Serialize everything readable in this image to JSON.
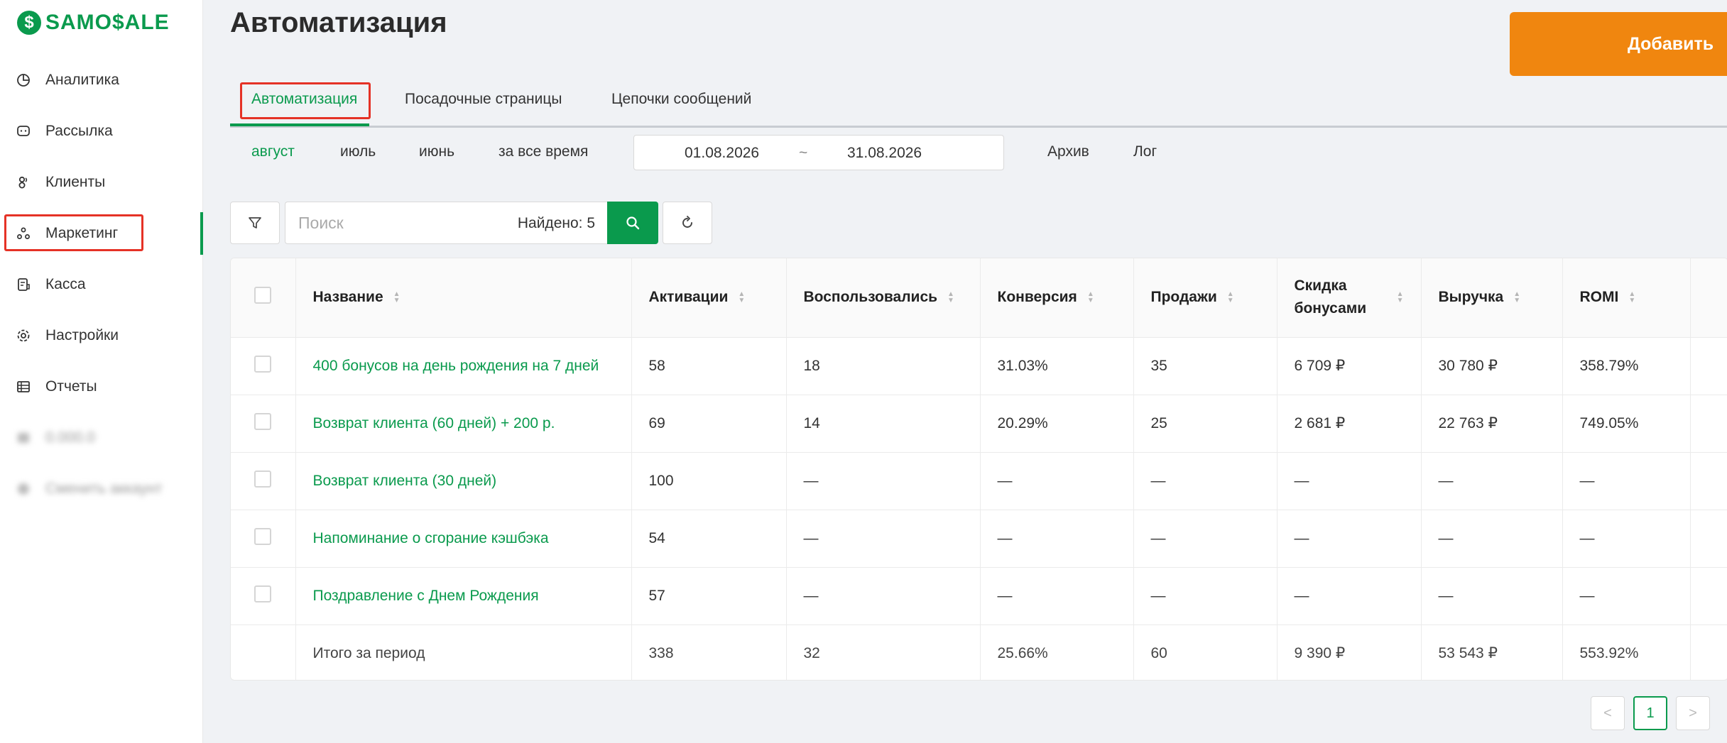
{
  "brand": {
    "logo_glyph": "$",
    "name": "SAMO$ALE",
    "color": "#0a9a4d"
  },
  "sidebar": {
    "items": [
      {
        "label": "Аналитика",
        "icon": "pie-chart-icon"
      },
      {
        "label": "Рассылка",
        "icon": "message-icon"
      },
      {
        "label": "Клиенты",
        "icon": "users-icon"
      },
      {
        "label": "Маркетинг",
        "icon": "marketing-icon",
        "active": true
      },
      {
        "label": "Касса",
        "icon": "cash-register-icon"
      },
      {
        "label": "Настройки",
        "icon": "gear-icon"
      },
      {
        "label": "Отчеты",
        "icon": "table-icon"
      },
      {
        "label": "0.000.0",
        "icon": "blurred-icon"
      },
      {
        "label": "Сменить аккаунт",
        "icon": "blurred-icon"
      }
    ]
  },
  "header": {
    "title": "Автоматизация",
    "add_label": "Добавить",
    "accent": "#f0860f"
  },
  "tabs": [
    {
      "label": "Автоматизация",
      "active": true
    },
    {
      "label": "Посадочные страницы"
    },
    {
      "label": "Цепочки сообщений"
    }
  ],
  "periods": [
    {
      "label": "август",
      "active": true
    },
    {
      "label": "июль"
    },
    {
      "label": "июнь"
    },
    {
      "label": "за все время"
    }
  ],
  "date_range": {
    "from": "01.08.2026",
    "sep": "~",
    "to": "31.08.2026"
  },
  "links": {
    "archive": "Архив",
    "log": "Лог"
  },
  "search": {
    "placeholder": "Поиск",
    "found": "Найдено: 5"
  },
  "table": {
    "columns": [
      "Название",
      "Активации",
      "Воспользовались",
      "Конверсия",
      "Продажи",
      "Скидка бонусами",
      "Выручка",
      "ROMI"
    ],
    "rows": [
      [
        "400 бонусов на день рождения на 7 дней",
        "58",
        "18",
        "31.03%",
        "35",
        "6 709 ₽",
        "30 780 ₽",
        "358.79%"
      ],
      [
        "Возврат клиента (60 дней) + 200 р.",
        "69",
        "14",
        "20.29%",
        "25",
        "2 681 ₽",
        "22 763 ₽",
        "749.05%"
      ],
      [
        "Возврат клиента (30 дней)",
        "100",
        "—",
        "—",
        "—",
        "—",
        "—",
        "—"
      ],
      [
        "Напоминание о сгорание кэшбэка",
        "54",
        "—",
        "—",
        "—",
        "—",
        "—",
        "—"
      ],
      [
        "Поздравление с Днем Рождения",
        "57",
        "—",
        "—",
        "—",
        "—",
        "—",
        "—"
      ]
    ],
    "total": [
      "Итого за период",
      "338",
      "32",
      "25.66%",
      "60",
      "9 390 ₽",
      "53 543 ₽",
      "553.92%"
    ]
  },
  "pagination": {
    "prev": "<",
    "current": "1",
    "next": ">"
  }
}
